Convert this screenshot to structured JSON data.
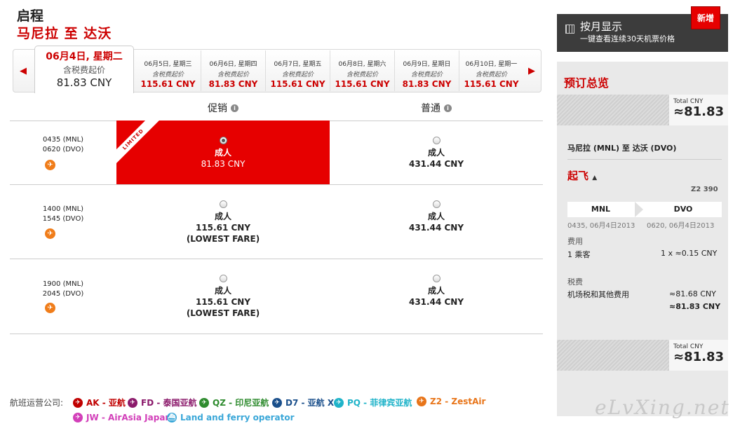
{
  "header": {
    "title": "启程",
    "route": "马尼拉 至 达沃"
  },
  "date_tabs": [
    {
      "date": "06月4日, 星期二",
      "sub": "含税费起价",
      "price": "81.83 CNY",
      "active": true
    },
    {
      "date": "06月5日, 星期三",
      "sub": "含税费起价",
      "price": "115.61 CNY"
    },
    {
      "date": "06月6日, 星期四",
      "sub": "含税费起价",
      "price": "81.83 CNY"
    },
    {
      "date": "06月7日, 星期五",
      "sub": "含税费起价",
      "price": "115.61 CNY"
    },
    {
      "date": "06月8日, 星期六",
      "sub": "含税费起价",
      "price": "115.61 CNY"
    },
    {
      "date": "06月9日, 星期日",
      "sub": "含税费起价",
      "price": "81.83 CNY"
    },
    {
      "date": "06月10日, 星期一",
      "sub": "含税费起价",
      "price": "115.61 CNY"
    }
  ],
  "columns": {
    "promo": "促销",
    "regular": "普通"
  },
  "flights": [
    {
      "dep": "0435 (MNL)",
      "arr": "0620 (DVO)",
      "promo": {
        "pax": "成人",
        "price": "81.83 CNY",
        "note": "",
        "selected": true,
        "ribbon": "LIMITED"
      },
      "regular": {
        "pax": "成人",
        "price": "431.44 CNY"
      }
    },
    {
      "dep": "1400 (MNL)",
      "arr": "1545 (DVO)",
      "promo": {
        "pax": "成人",
        "price": "115.61 CNY",
        "note": "(LOWEST FARE)"
      },
      "regular": {
        "pax": "成人",
        "price": "431.44 CNY"
      }
    },
    {
      "dep": "1900 (MNL)",
      "arr": "2045 (DVO)",
      "promo": {
        "pax": "成人",
        "price": "115.61 CNY",
        "note": "(LOWEST FARE)"
      },
      "regular": {
        "pax": "成人",
        "price": "431.44 CNY"
      }
    }
  ],
  "airlines": {
    "label": "航班运营公司:",
    "items": [
      {
        "code": "AK - 亚航",
        "color": "#c00000"
      },
      {
        "code": "FD - 泰国亚航",
        "color": "#8b1a6b"
      },
      {
        "code": "QZ - 印尼亚航",
        "color": "#2e8b2e"
      },
      {
        "code": "D7 - 亚航 X",
        "color": "#1a4f8b"
      },
      {
        "code": "PQ - 菲律宾亚航",
        "color": "#1fb3c9"
      },
      {
        "code": "Z2 - ZestAir",
        "color": "#e8751a"
      },
      {
        "code": "JW - AirAsia Japan",
        "color": "#d23fb9"
      },
      {
        "code": "Land and ferry operator",
        "color": "#3aa7d8"
      }
    ]
  },
  "sidebar": {
    "monthly_title": "按月显示",
    "monthly_sub": "一键查看连续30天机票价格",
    "new_badge": "新增",
    "summary_title": "预订总览",
    "total_label": "Total CNY",
    "total_value": "≈81.83",
    "route": "马尼拉 (MNL) 至 达沃 (DVO)",
    "depart_label": "起飞",
    "flight_no": "Z2 390",
    "seg_from": "MNL",
    "seg_to": "DVO",
    "seg_from_time": "0435, 06月4日2013",
    "seg_to_time": "0620, 06月4日2013",
    "fare_label": "费用",
    "passengers": "1 乘客",
    "fare_value": "1 x ≈0.15 CNY",
    "tax_label": "税费",
    "tax_desc": "机场税和其他费用",
    "tax_value": "≈81.68 CNY",
    "tax_total": "≈81.83 CNY",
    "bottom_total_label": "Total CNY",
    "bottom_total_value": "≈81.83"
  },
  "watermark": "eLvXing.net"
}
